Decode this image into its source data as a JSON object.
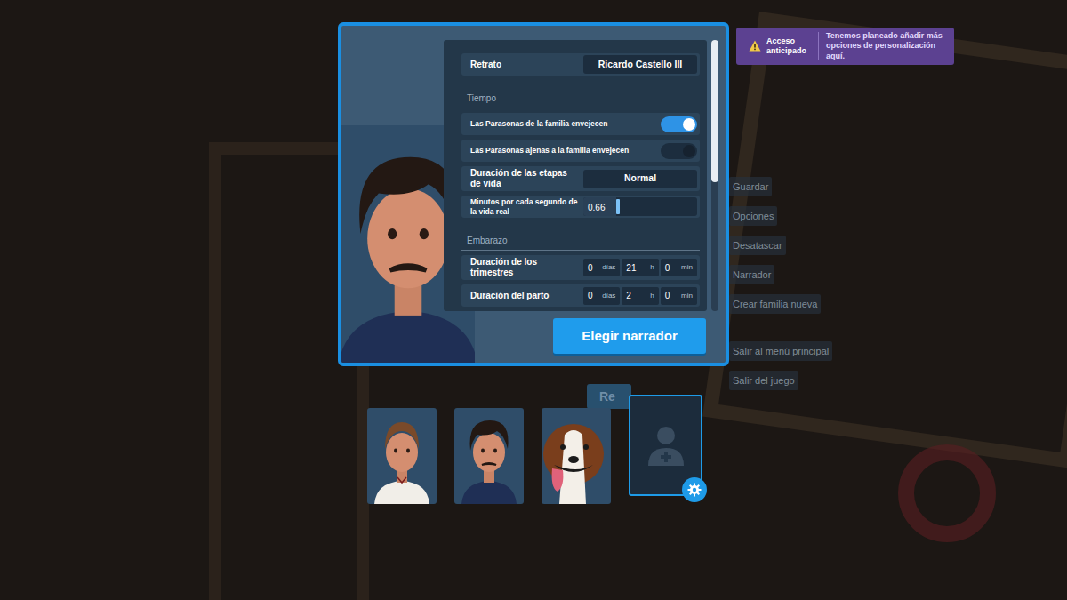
{
  "badge": {
    "title": "Acceso anticipado",
    "message": "Tenemos planeado añadir más opciones de personalización aquí."
  },
  "settings": {
    "rows": [
      {
        "kind": "select",
        "label": "Retrato",
        "value": "Ricardo Castello III"
      },
      {
        "kind": "section",
        "label": "Tiempo"
      },
      {
        "kind": "toggle",
        "label": "Las Parasonas de la familia envejecen",
        "on": true
      },
      {
        "kind": "toggle",
        "label": "Las Parasonas ajenas a la familia envejecen",
        "on": false
      },
      {
        "kind": "select",
        "label": "Duración de las etapas de vida",
        "value": "Normal"
      },
      {
        "kind": "slider",
        "label": "Minutos por cada segundo de la vida real",
        "value": "0.66",
        "level": 0.29
      },
      {
        "kind": "section",
        "label": "Embarazo"
      },
      {
        "kind": "duration",
        "label": "Duración de los trimestres",
        "fields": [
          {
            "value": "0",
            "unit": "días"
          },
          {
            "value": "21",
            "unit": "h"
          },
          {
            "value": "0",
            "unit": "min"
          }
        ]
      },
      {
        "kind": "duration",
        "label": "Duración del parto",
        "fields": [
          {
            "value": "0",
            "unit": "días"
          },
          {
            "value": "2",
            "unit": "h"
          },
          {
            "value": "0",
            "unit": "min"
          }
        ]
      }
    ]
  },
  "confirm_button": "Elegir narrador",
  "menu": {
    "items": [
      "Guardar",
      "Opciones",
      "Desatascar",
      "Narrador",
      "Crear familia nueva",
      "Salir al menú principal",
      "Salir del juego"
    ]
  },
  "covered_button": "Re",
  "family": {
    "members": [
      {
        "kind": "woman"
      },
      {
        "kind": "man"
      },
      {
        "kind": "dog"
      },
      {
        "kind": "add"
      }
    ]
  }
}
